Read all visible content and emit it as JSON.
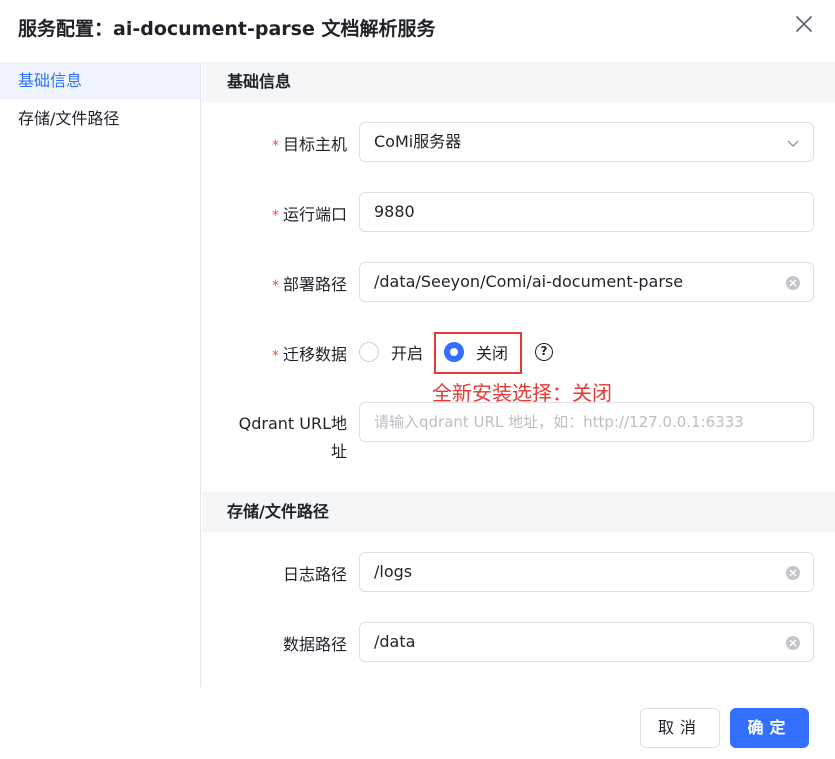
{
  "dialog": {
    "title": "服务配置：ai-document-parse 文档解析服务",
    "close_icon": "close-icon"
  },
  "sidebar": {
    "items": [
      {
        "label": "基础信息",
        "active": true
      },
      {
        "label": "存储/文件路径",
        "active": false
      }
    ]
  },
  "sections": {
    "basic": {
      "title": "基础信息",
      "target_host": {
        "label": "目标主机",
        "required": "*",
        "value": "CoMi服务器"
      },
      "port": {
        "label": "运行端口",
        "required": "*",
        "value": "9880"
      },
      "deploy_path": {
        "label": "部署路径",
        "required": "*",
        "value": "/data/Seeyon/Comi/ai-document-parse"
      },
      "migrate": {
        "label": "迁移数据",
        "required": "*",
        "options": [
          {
            "label": "开启",
            "checked": false
          },
          {
            "label": "关闭",
            "checked": true
          }
        ],
        "help_icon": "?"
      },
      "annotation": "全新安装选择：关闭",
      "qdrant": {
        "label_line1": "Qdrant URL地",
        "label_line2": "址",
        "placeholder": "请输入qdrant URL 地址，如：http://127.0.0.1:6333"
      }
    },
    "storage": {
      "title": "存储/文件路径",
      "log_path": {
        "label": "日志路径",
        "value": "/logs"
      },
      "data_path": {
        "label": "数据路径",
        "value": "/data"
      }
    }
  },
  "footer": {
    "cancel_label": "取消",
    "ok_label": "确定"
  },
  "colors": {
    "primary": "#3370ff",
    "required": "#f54a45",
    "annotation": "#e53935",
    "section_bg": "#f5f6f7",
    "active_bg": "#eef3fd"
  }
}
